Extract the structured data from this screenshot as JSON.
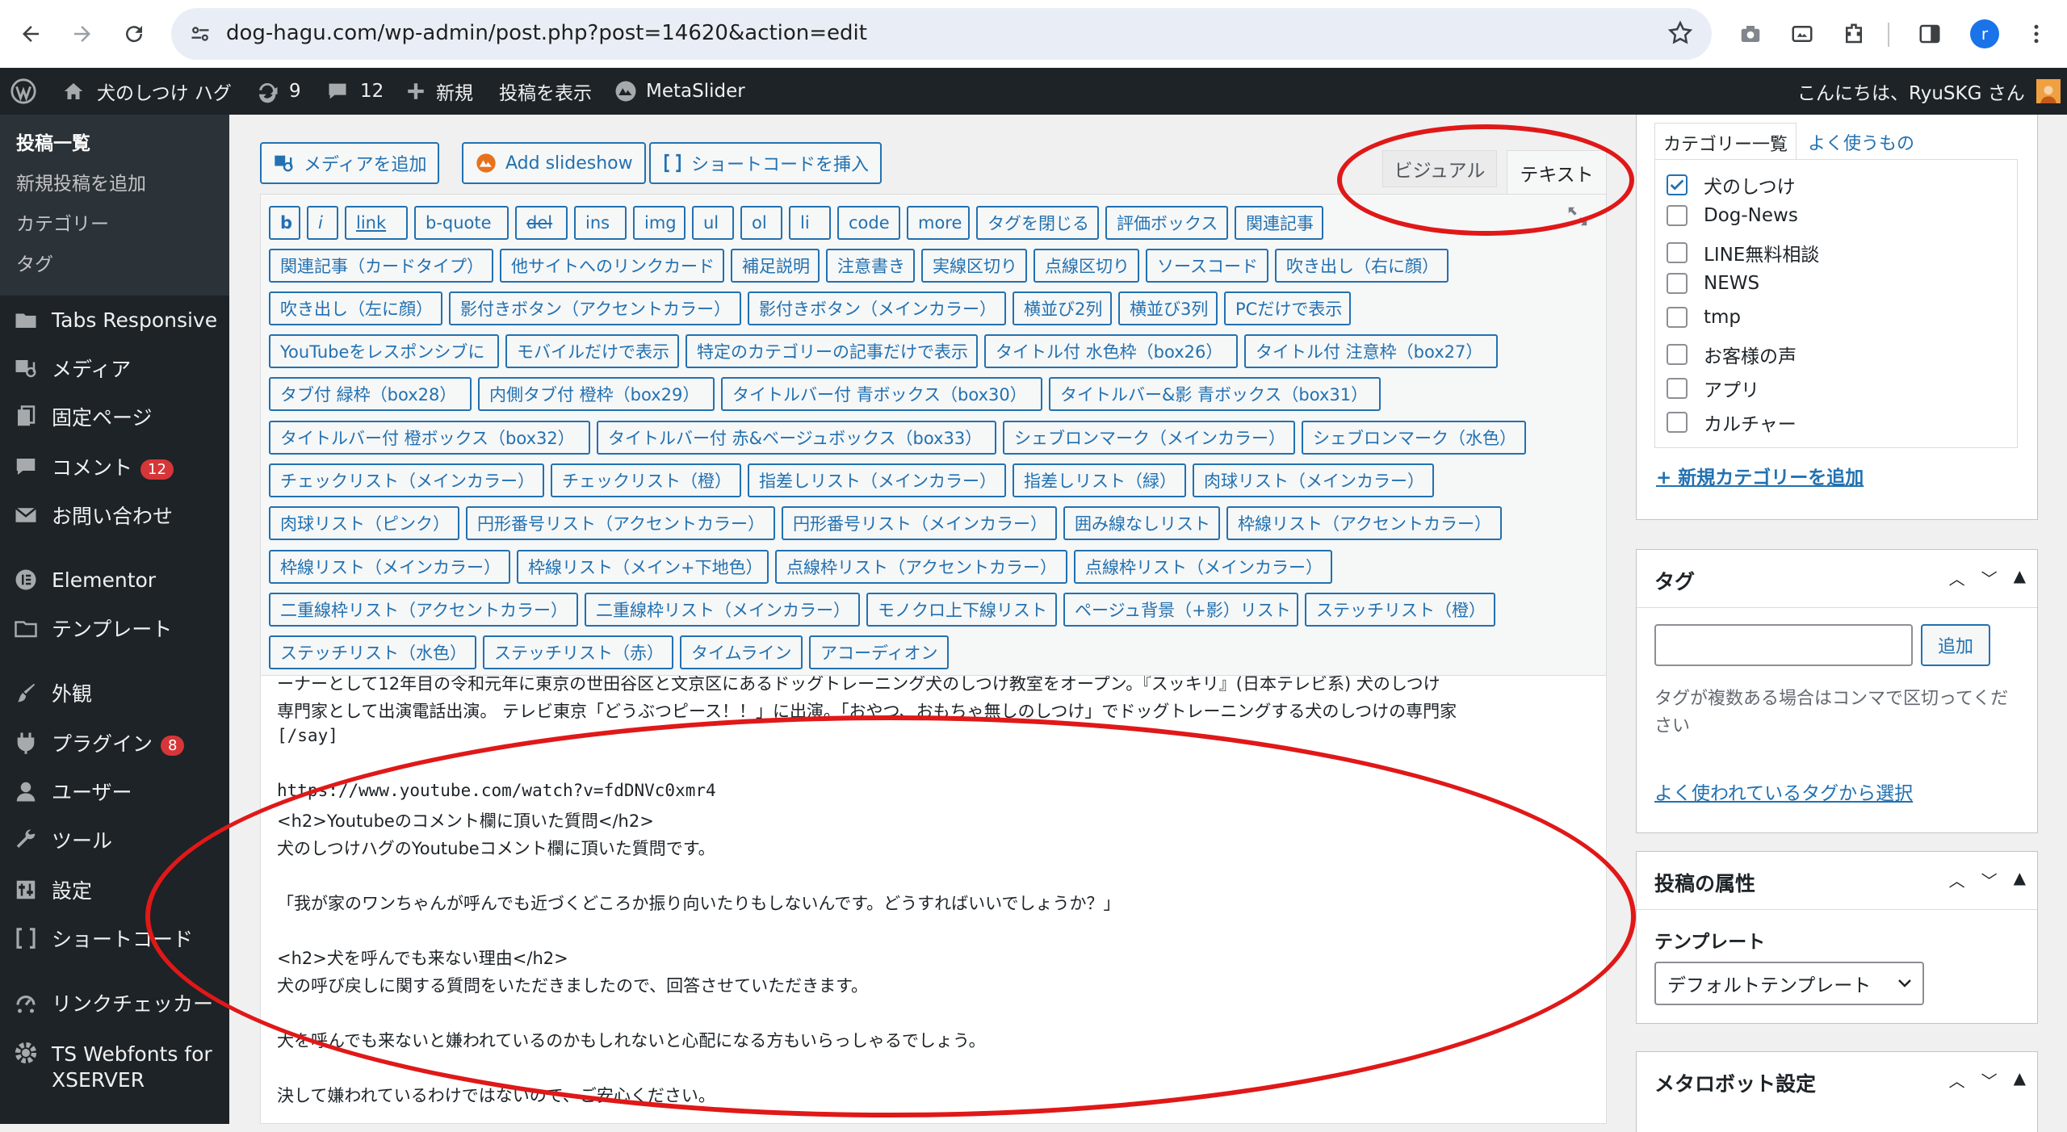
{
  "browser": {
    "url": "dog-hagu.com/wp-admin/post.php?post=14620&action=edit",
    "avatar_letter": "r"
  },
  "admin_bar": {
    "site_name": "犬のしつけ ハグ",
    "updates_count": "9",
    "comments_count": "12",
    "new_label": "新規",
    "view_post_label": "投稿を表示",
    "metaslider_label": "MetaSlider",
    "greeting": "こんにちは、RyuSKG さん"
  },
  "sidebar": {
    "submenu": [
      "投稿一覧",
      "新規投稿を追加",
      "カテゴリー",
      "タグ"
    ],
    "items": [
      {
        "label": "Tabs Responsive",
        "icon": "folder-icon"
      },
      {
        "label": "メディア",
        "icon": "media-icon"
      },
      {
        "label": "固定ページ",
        "icon": "pages-icon"
      },
      {
        "label": "コメント",
        "icon": "comment-icon",
        "badge": "12"
      },
      {
        "label": "お問い合わせ",
        "icon": "mail-icon"
      },
      {
        "label": "Elementor",
        "icon": "elementor-icon"
      },
      {
        "label": "テンプレート",
        "icon": "folder-icon"
      },
      {
        "label": "外観",
        "icon": "brush-icon"
      },
      {
        "label": "プラグイン",
        "icon": "plugin-icon",
        "badge": "8"
      },
      {
        "label": "ユーザー",
        "icon": "user-icon"
      },
      {
        "label": "ツール",
        "icon": "wrench-icon"
      },
      {
        "label": "設定",
        "icon": "settings-icon"
      },
      {
        "label": "ショートコード",
        "icon": "shortcode-icon"
      },
      {
        "label": "リンクチェッカー",
        "icon": "link-checker-icon"
      },
      {
        "label": "TS Webfonts for XSERVER",
        "icon": "gear-icon"
      }
    ]
  },
  "editor": {
    "add_media": "メディアを追加",
    "add_slideshow": "Add slideshow",
    "insert_shortcode": "ショートコードを挿入",
    "tab_visual": "ビジュアル",
    "tab_text": "テキスト",
    "quicktags": [
      [
        "b",
        "i",
        "link",
        "b-quote",
        "del",
        "ins",
        "img",
        "ul",
        "ol",
        "li",
        "code",
        "more",
        "タグを閉じる",
        "評価ボックス",
        "関連記事"
      ],
      [
        "関連記事（カードタイプ）",
        "他サイトへのリンクカード",
        "補足説明",
        "注意書き",
        "実線区切り",
        "点線区切り",
        "ソースコード",
        "吹き出し（右に顔）"
      ],
      [
        "吹き出し（左に顔）",
        "影付きボタン（アクセントカラー）",
        "影付きボタン（メインカラー）",
        "横並び2列",
        "横並び3列",
        "PCだけで表示"
      ],
      [
        "YouTubeをレスポンシブに",
        "モバイルだけで表示",
        "特定のカテゴリーの記事だけで表示",
        "タイトル付 水色枠（box26）",
        "タイトル付 注意枠（box27）"
      ],
      [
        "タブ付 緑枠（box28）",
        "内側タブ付 橙枠（box29）",
        "タイトルバー付 青ボックス（box30）",
        "タイトルバー&影 青ボックス（box31）"
      ],
      [
        "タイトルバー付 橙ボックス（box32）",
        "タイトルバー付 赤&ベージュボックス（box33）",
        "シェブロンマーク（メインカラー）",
        "シェブロンマーク（水色）"
      ],
      [
        "チェックリスト（メインカラー）",
        "チェックリスト（橙）",
        "指差しリスト（メインカラー）",
        "指差しリスト（緑）",
        "肉球リスト（メインカラー）"
      ],
      [
        "肉球リスト（ピンク）",
        "円形番号リスト（アクセントカラー）",
        "円形番号リスト（メインカラー）",
        "囲み線なしリスト",
        "枠線リスト（アクセントカラー）"
      ],
      [
        "枠線リスト（メインカラー）",
        "枠線リスト（メイン+下地色）",
        "点線枠リスト（アクセントカラー）",
        "点線枠リスト（メインカラー）"
      ],
      [
        "二重線枠リスト（アクセントカラー）",
        "二重線枠リスト（メインカラー）",
        "モノクロ上下線リスト",
        "ページュ背景（+影）リスト",
        "ステッチリスト（橙）"
      ],
      [
        "ステッチリスト（水色）",
        "ステッチリスト（赤）",
        "タイムライン",
        "アコーディオン"
      ]
    ],
    "content_lines": [
      "ーナーとして12年目の令和元年に東京の世田谷区と文京区にあるドッグトレーニング犬のしつけ教室をオープン。『スッキリ』(日本テレビ系) 犬のしつけ",
      "専門家として出演電話出演。 テレビ東京「どうぶつピース！！」に出演。「おやつ、おもちゃ無しのしつけ」でドッグトレーニングする犬のしつけの専門家",
      "[/say]",
      "",
      "https://www.youtube.com/watch?v=fdDNVc0xmr4",
      "<h2>Youtubeのコメント欄に頂いた質問</h2>",
      "犬のしつけハグのYoutubeコメント欄に頂いた質問です。",
      "",
      "「我が家のワンちゃんが呼んでも近づくどころか振り向いたりもしないんです。どうすればいいでしょうか？」",
      "",
      "<h2>犬を呼んでも来ない理由</h2>",
      "犬の呼び戻しに関する質問をいただきましたので、回答させていただきます。",
      "",
      "犬を呼んでも来ないと嫌われているのかもしれないと心配になる方もいらっしゃるでしょう。",
      "",
      "決して嫌われているわけではないので、ご安心ください。"
    ]
  },
  "categories": {
    "tab_all": "カテゴリー一覧",
    "tab_popular": "よく使うもの",
    "items": [
      {
        "label": "犬のしつけ",
        "checked": true
      },
      {
        "label": "Dog-News",
        "checked": false
      },
      {
        "label": "LINE無料相談",
        "checked": false
      },
      {
        "label": "NEWS",
        "checked": false
      },
      {
        "label": "tmp",
        "checked": false
      },
      {
        "label": "お客様の声",
        "checked": false
      },
      {
        "label": "アプリ",
        "checked": false
      },
      {
        "label": "カルチャー",
        "checked": false
      }
    ],
    "add_new": "+ 新規カテゴリーを追加"
  },
  "tags": {
    "title": "タグ",
    "add_button": "追加",
    "help": "タグが複数ある場合はコンマで区切ってください",
    "choose_link": "よく使われているタグから選択"
  },
  "post_attributes": {
    "title": "投稿の属性",
    "template_label": "テンプレート",
    "template_value": "デフォルトテンプレート"
  },
  "metarobots": {
    "title": "メタロボット設定"
  },
  "colors": {
    "annotation": "#e01818",
    "wp_blue": "#2271b1",
    "admin_dark": "#1d2327"
  }
}
